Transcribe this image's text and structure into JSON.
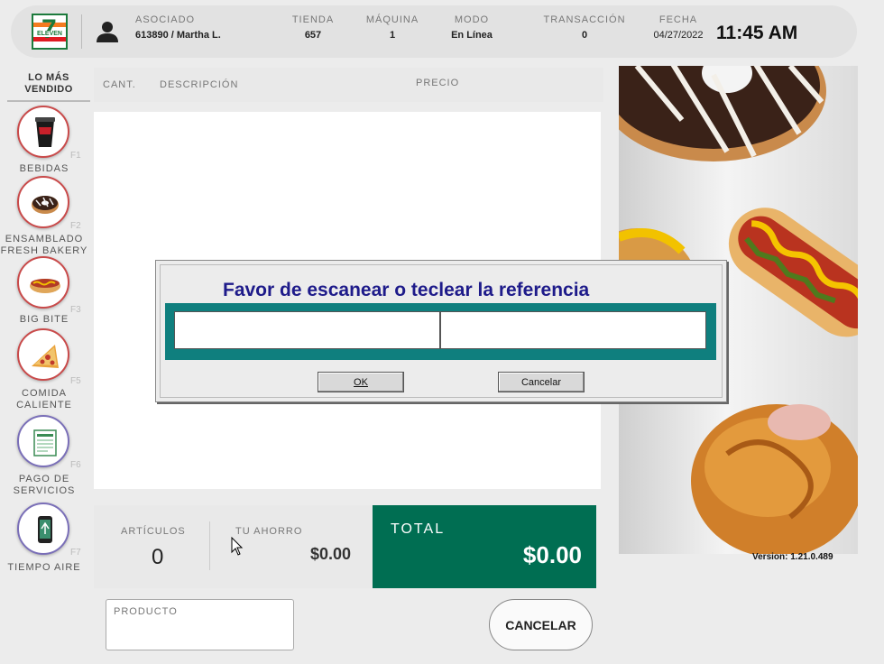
{
  "header": {
    "asociado_label": "ASOCIADO",
    "asociado_value": "613890 / Martha L.",
    "tienda_label": "TIENDA",
    "tienda_value": "657",
    "maquina_label": "MÁQUINA",
    "maquina_value": "1",
    "modo_label": "MODO",
    "modo_value": "En Línea",
    "transaccion_label": "TRANSACCIÓN",
    "transaccion_value": "0",
    "fecha_label": "FECHA",
    "fecha_value": "04/27/2022",
    "time": "11:45 AM"
  },
  "logo": {
    "number": "7",
    "text": "ELEVEN"
  },
  "sidebar": {
    "title": "LO MÁS VENDIDO",
    "items": [
      {
        "label": "BEBIDAS",
        "fkey": "F1",
        "icon": "drink-cup-icon"
      },
      {
        "label": "ENSAMBLADO FRESH BAKERY",
        "fkey": "F2",
        "icon": "donut-icon"
      },
      {
        "label": "BIG BITE",
        "fkey": "F3",
        "icon": "hotdog-icon"
      },
      {
        "label": "COMIDA CALIENTE",
        "fkey": "F5",
        "icon": "pizza-icon"
      },
      {
        "label": "PAGO DE SERVICIOS",
        "fkey": "F6",
        "icon": "bill-icon"
      },
      {
        "label": "TIEMPO AIRE",
        "fkey": "F7",
        "icon": "phone-icon"
      }
    ]
  },
  "table": {
    "col_qty": "CANT.",
    "col_desc": "DESCRIPCIÓN",
    "col_price": "PRECIO"
  },
  "totals": {
    "articulos_label": "ARTÍCULOS",
    "articulos_value": "0",
    "ahorro_label": "TU AHORRO",
    "ahorro_value": "$0.00",
    "total_label": "TOTAL",
    "total_value": "$0.00"
  },
  "product_field": {
    "label": "PRODUCTO"
  },
  "cancel_button": "CANCELAR",
  "version": "Version: 1.21.0.489",
  "dialog": {
    "title": "Favor de escanear o teclear la referencia",
    "ok_label": "OK",
    "cancel_label": "Cancelar"
  },
  "colors": {
    "brand_green": "#006e52",
    "dialog_teal": "#0f7f7e",
    "dialog_title": "#1e1b8a"
  }
}
